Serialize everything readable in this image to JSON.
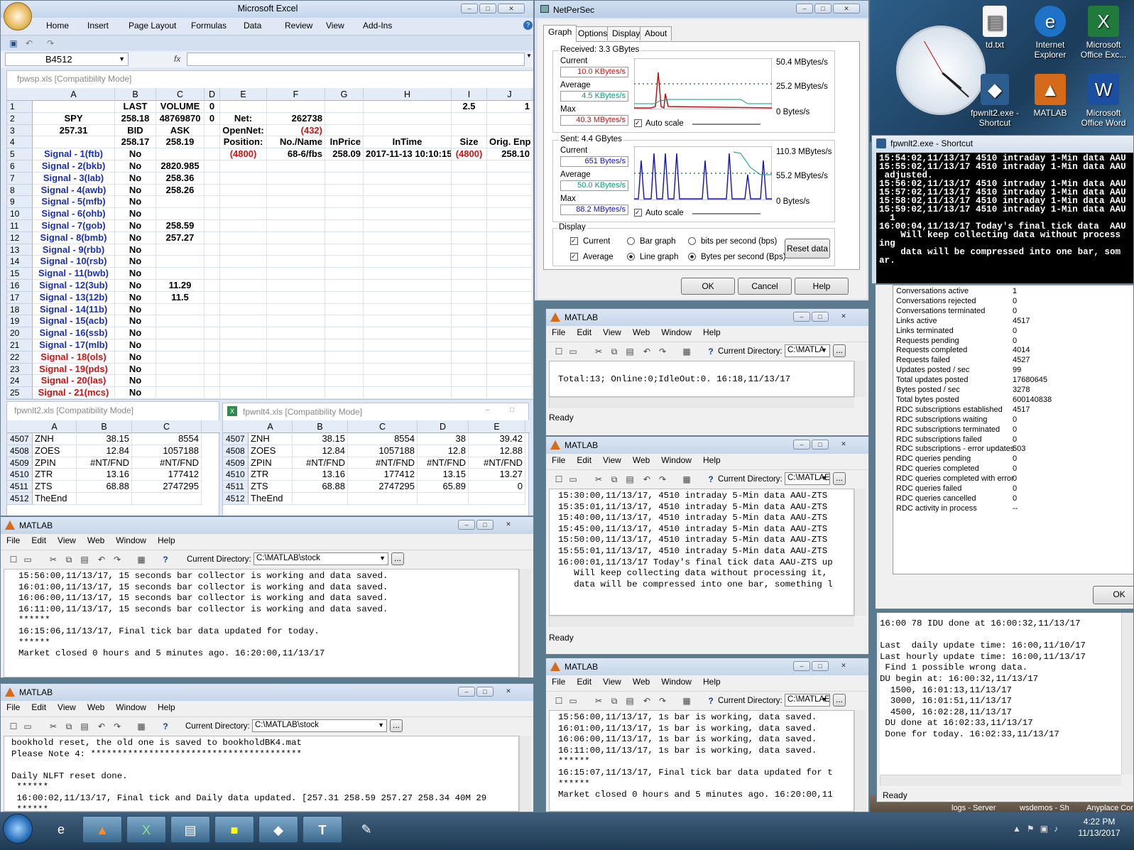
{
  "excel": {
    "title": "Microsoft Excel",
    "ribbon_tabs": [
      "Home",
      "Insert",
      "Page Layout",
      "Formulas",
      "Data",
      "Review",
      "View",
      "Add-Ins"
    ],
    "name_box": "B4512",
    "fx": "fx",
    "wb1_title": "fpwsp.xls  [Compatibility Mode]",
    "col_headers": [
      "A",
      "B",
      "C",
      "D",
      "E",
      "F",
      "G",
      "H",
      "I",
      "J"
    ],
    "rows": [
      {
        "n": "1",
        "a": "",
        "b": "LAST",
        "c": "VOLUME",
        "d": "0",
        "e": "",
        "f": "",
        "g": "",
        "h": "",
        "i": "2.5",
        "j": "1"
      },
      {
        "n": "2",
        "a": "SPY",
        "b": "258.18",
        "c": "48769870",
        "d": "0",
        "e": "Net:",
        "f": "262738",
        "g": "",
        "h": "",
        "i": "",
        "j": ""
      },
      {
        "n": "3",
        "a": "257.31",
        "b": "BID",
        "c": "ASK",
        "d": "",
        "e": "OpenNet:",
        "f": "(432)",
        "g": "",
        "h": "",
        "i": "",
        "j": ""
      },
      {
        "n": "4",
        "a": "",
        "b": "258.17",
        "c": "258.19",
        "d": "",
        "e": "Position:",
        "f": "No./Name",
        "g": "InPrice",
        "h": "InTime",
        "i": "Size",
        "j": "Orig. Enp"
      },
      {
        "n": "5",
        "a": "Signal - 1(ftb)",
        "b": "No",
        "c": "",
        "d": "",
        "e": "(4800)",
        "f": "68-6/fbs",
        "g": "258.09",
        "h": "2017-11-13 10:10:15",
        "i": "(4800)",
        "j": "258.10"
      },
      {
        "n": "6",
        "a": "Signal - 2(bkb)",
        "b": "No",
        "c": "2820.985",
        "d": "",
        "e": "",
        "f": "",
        "g": "",
        "h": "",
        "i": "",
        "j": ""
      },
      {
        "n": "7",
        "a": "Signal - 3(lab)",
        "b": "No",
        "c": "258.36",
        "d": "",
        "e": "",
        "f": "",
        "g": "",
        "h": "",
        "i": "",
        "j": ""
      },
      {
        "n": "8",
        "a": "Signal - 4(awb)",
        "b": "No",
        "c": "258.26",
        "d": "",
        "e": "",
        "f": "",
        "g": "",
        "h": "",
        "i": "",
        "j": ""
      },
      {
        "n": "9",
        "a": "Signal - 5(mfb)",
        "b": "No",
        "c": "",
        "d": "",
        "e": "",
        "f": "",
        "g": "",
        "h": "",
        "i": "",
        "j": ""
      },
      {
        "n": "10",
        "a": "Signal - 6(ohb)",
        "b": "No",
        "c": "",
        "d": "",
        "e": "",
        "f": "",
        "g": "",
        "h": "",
        "i": "",
        "j": ""
      },
      {
        "n": "11",
        "a": "Signal - 7(gob)",
        "b": "No",
        "c": "258.59",
        "d": "",
        "e": "",
        "f": "",
        "g": "",
        "h": "",
        "i": "",
        "j": ""
      },
      {
        "n": "12",
        "a": "Signal - 8(bmb)",
        "b": "No",
        "c": "257.27",
        "d": "",
        "e": "",
        "f": "",
        "g": "",
        "h": "",
        "i": "",
        "j": ""
      },
      {
        "n": "13",
        "a": "Signal - 9(rbb)",
        "b": "No",
        "c": "",
        "d": "",
        "e": "",
        "f": "",
        "g": "",
        "h": "",
        "i": "",
        "j": ""
      },
      {
        "n": "14",
        "a": "Signal - 10(rsb)",
        "b": "No",
        "c": "",
        "d": "",
        "e": "",
        "f": "",
        "g": "",
        "h": "",
        "i": "",
        "j": ""
      },
      {
        "n": "15",
        "a": "Signal - 11(bwb)",
        "b": "No",
        "c": "",
        "d": "",
        "e": "",
        "f": "",
        "g": "",
        "h": "",
        "i": "",
        "j": ""
      },
      {
        "n": "16",
        "a": "Signal - 12(3ub)",
        "b": "No",
        "c": "11.29",
        "d": "",
        "e": "",
        "f": "",
        "g": "",
        "h": "",
        "i": "",
        "j": ""
      },
      {
        "n": "17",
        "a": "Signal - 13(12b)",
        "b": "No",
        "c": "11.5",
        "d": "",
        "e": "",
        "f": "",
        "g": "",
        "h": "",
        "i": "",
        "j": ""
      },
      {
        "n": "18",
        "a": "Signal - 14(11b)",
        "b": "No",
        "c": "",
        "d": "",
        "e": "",
        "f": "",
        "g": "",
        "h": "",
        "i": "",
        "j": ""
      },
      {
        "n": "19",
        "a": "Signal - 15(acb)",
        "b": "No",
        "c": "",
        "d": "",
        "e": "",
        "f": "",
        "g": "",
        "h": "",
        "i": "",
        "j": ""
      },
      {
        "n": "20",
        "a": "Signal - 16(ssb)",
        "b": "No",
        "c": "",
        "d": "",
        "e": "",
        "f": "",
        "g": "",
        "h": "",
        "i": "",
        "j": ""
      },
      {
        "n": "21",
        "a": "Signal - 17(mlb)",
        "b": "No",
        "c": "",
        "d": "",
        "e": "",
        "f": "",
        "g": "",
        "h": "",
        "i": "",
        "j": ""
      },
      {
        "n": "22",
        "a": "Signal - 18(ols)",
        "b": "No",
        "c": "",
        "d": "",
        "e": "",
        "f": "",
        "g": "",
        "h": "",
        "i": "",
        "j": ""
      },
      {
        "n": "23",
        "a": "Signal - 19(pds)",
        "b": "No",
        "c": "",
        "d": "",
        "e": "",
        "f": "",
        "g": "",
        "h": "",
        "i": "",
        "j": ""
      },
      {
        "n": "24",
        "a": "Signal - 20(las)",
        "b": "No",
        "c": "",
        "d": "",
        "e": "",
        "f": "",
        "g": "",
        "h": "",
        "i": "",
        "j": ""
      },
      {
        "n": "25",
        "a": "Signal - 21(mcs)",
        "b": "No",
        "c": "",
        "d": "",
        "e": "",
        "f": "",
        "g": "",
        "h": "",
        "i": "",
        "j": ""
      }
    ],
    "wb2_title": "fpwnlt2.xls  [Compatibility Mode]",
    "wb2_cols": [
      "A",
      "B",
      "C"
    ],
    "wb2_rows": [
      {
        "n": "4507",
        "a": "ZNH",
        "b": "38.15",
        "c": "8554"
      },
      {
        "n": "4508",
        "a": "ZOES",
        "b": "12.84",
        "c": "1057188"
      },
      {
        "n": "4509",
        "a": "ZPIN",
        "b": "#NT/FND",
        "c": "#NT/FND"
      },
      {
        "n": "4510",
        "a": "ZTR",
        "b": "13.16",
        "c": "177412"
      },
      {
        "n": "4511",
        "a": "ZTS",
        "b": "68.88",
        "c": "2747295"
      },
      {
        "n": "4512",
        "a": "TheEnd",
        "b": "",
        "c": ""
      }
    ],
    "wb3_title": "fpwnlt4.xls  [Compatibility Mode]",
    "wb3_cols": [
      "A",
      "B",
      "C",
      "D",
      "E"
    ],
    "wb3_rows": [
      {
        "n": "4507",
        "a": "ZNH",
        "b": "38.15",
        "c": "8554",
        "d": "38",
        "e": "39.42"
      },
      {
        "n": "4508",
        "a": "ZOES",
        "b": "12.84",
        "c": "1057188",
        "d": "12.8",
        "e": "12.88"
      },
      {
        "n": "4509",
        "a": "ZPIN",
        "b": "#NT/FND",
        "c": "#NT/FND",
        "d": "#NT/FND",
        "e": "#NT/FND"
      },
      {
        "n": "4510",
        "a": "ZTR",
        "b": "13.16",
        "c": "177412",
        "d": "13.15",
        "e": "13.27"
      },
      {
        "n": "4511",
        "a": "ZTS",
        "b": "68.88",
        "c": "2747295",
        "d": "65.89",
        "e": "0"
      },
      {
        "n": "4512",
        "a": "TheEnd",
        "b": "",
        "c": "",
        "d": "",
        "e": ""
      }
    ]
  },
  "matlab": {
    "title": "MATLAB",
    "menu": [
      "File",
      "Edit",
      "View",
      "Web",
      "Window",
      "Help"
    ],
    "cd_label": "Current Directory:",
    "ready": "Ready",
    "m1_dir": "C:\\MATLAB\\stock",
    "m1_lines": [
      "15:56:00,11/13/17, 15 seconds bar collector is working and data saved.",
      "16:01:00,11/13/17, 15 seconds bar collector is working and data saved.",
      "16:06:00,11/13/17, 15 seconds bar collector is working and data saved.",
      "16:11:00,11/13/17, 15 seconds bar collector is working and data saved.",
      "******",
      "16:15:06,11/13/17, Final tick bar data updated for today.",
      "******",
      "Market closed 0 hours and 5 minutes ago. 16:20:00,11/13/17"
    ],
    "m2_dir": "C:\\MATLAB\\stock",
    "m2_lines": [
      "bookhold reset, the old one is saved to bookholdBK4.mat",
      "Please Note 4: ****************************************",
      "",
      "Daily NLFT reset done.",
      " ******",
      " 16:00:02,11/13/17, Final tick and Daily data updated. [257.31 258.59 257.27 258.34 40M 29",
      " ******"
    ],
    "m3_dir": "C:\\MATLA",
    "m3_lines": [
      "",
      "Total:13; Online:0;IdleOut:0. 16:18,11/13/17"
    ],
    "m4_dir": "C:\\MATLAE",
    "m4_lines": [
      "15:30:00,11/13/17, 4510 intraday 5-Min data AAU-ZTS",
      "15:35:01,11/13/17, 4510 intraday 5-Min data AAU-ZTS",
      "15:40:00,11/13/17, 4510 intraday 5-Min data AAU-ZTS",
      "15:45:00,11/13/17, 4510 intraday 5-Min data AAU-ZTS",
      "15:50:00,11/13/17, 4510 intraday 5-Min data AAU-ZTS",
      "15:55:01,11/13/17, 4510 intraday 5-Min data AAU-ZTS",
      "16:00:01,11/13/17 Today's final tick data AAU-ZTS up",
      "   Will keep collecting data without processing it,",
      "   data will be compressed into one bar, something l"
    ],
    "m5_dir": "C:\\MATLAE",
    "m5_lines": [
      "15:56:00,11/13/17, 1s bar is working, data saved.",
      "16:01:00,11/13/17, 1s bar is working, data saved.",
      "16:06:00,11/13/17, 1s bar is working, data saved.",
      "16:11:00,11/13/17, 1s bar is working, data saved.",
      "******",
      "16:15:07,11/13/17, Final tick bar data updated for t",
      "******",
      "Market closed 0 hours and 5 minutes ago. 16:20:00,11"
    ]
  },
  "netpersec": {
    "title": "NetPerSec",
    "tabs": [
      "Graph",
      "Options",
      "Display",
      "About"
    ],
    "received_title": "Received: 3.3 GBytes",
    "sent_title": "Sent: 4.4 GBytes",
    "lbl_current": "Current",
    "lbl_average": "Average",
    "lbl_max": "Max",
    "recv_current": "10.0 KBytes/s",
    "recv_average": "4.5 KBytes/s",
    "recv_max": "40.3 MBytes/s",
    "recv_scale": [
      "50.4 MBytes/s",
      "25.2 MBytes/s",
      "0  Bytes/s"
    ],
    "sent_current": "651  Bytes/s",
    "sent_average": "50.0 KBytes/s",
    "sent_max": "88.2 MBytes/s",
    "sent_scale": [
      "110.3 MBytes/s",
      "55.2 MBytes/s",
      "0  Bytes/s"
    ],
    "auto_scale": "Auto scale",
    "display_title": "Display",
    "opt_current": "Current",
    "opt_average": "Average",
    "opt_bar": "Bar graph",
    "opt_line": "Line graph",
    "opt_bits": "bits per second (bps)",
    "opt_bytes": "Bytes per second (Bps)",
    "reset": "Reset data",
    "ok": "OK",
    "cancel": "Cancel",
    "help": "Help",
    "colors": {
      "received_value": "#d01010",
      "average_value": "#00a080",
      "sent_value": "#1010d0"
    }
  },
  "console": {
    "title": "fpwnlt2.exe - Shortcut",
    "lines": [
      "15:54:02,11/13/17 4510 intraday 1-Min data AAU",
      "15:55:02,11/13/17 4510 intraday 1-Min data AAU",
      " adjusted.",
      "15:56:02,11/13/17 4510 intraday 1-Min data AAU",
      "15:57:02,11/13/17 4510 intraday 1-Min data AAU",
      "15:58:02,11/13/17 4510 intraday 1-Min data AAU",
      "15:59:02,11/13/17 4510 intraday 1-Min data AAU",
      "  1",
      "16:00:04,11/13/17 Today's final tick data  AAU",
      "    Will keep collecting data without process",
      "ing",
      "    data will be compressed into one bar, som",
      "ar."
    ]
  },
  "rdc": {
    "items": [
      {
        "label": "Conversations active",
        "value": "1"
      },
      {
        "label": "Conversations rejected",
        "value": "0"
      },
      {
        "label": "Conversations terminated",
        "value": "0"
      },
      {
        "label": "Links active",
        "value": "4517"
      },
      {
        "label": "Links terminated",
        "value": "0"
      },
      {
        "label": "Requests pending",
        "value": "0"
      },
      {
        "label": "Requests completed",
        "value": "4014"
      },
      {
        "label": "Requests failed",
        "value": "4527"
      },
      {
        "label": "Updates posted / sec",
        "value": "99"
      },
      {
        "label": "Total updates posted",
        "value": "17680645"
      },
      {
        "label": "Bytes posted / sec",
        "value": "3278"
      },
      {
        "label": "Total bytes posted",
        "value": "600140838"
      },
      {
        "label": "RDC subscriptions established",
        "value": "4517"
      },
      {
        "label": "RDC subscriptions waiting",
        "value": "0"
      },
      {
        "label": "RDC subscriptions terminated",
        "value": "0"
      },
      {
        "label": "RDC subscriptions failed",
        "value": "0"
      },
      {
        "label": "RDC subscriptions - error updates",
        "value": "503"
      },
      {
        "label": "RDC queries pending",
        "value": "0"
      },
      {
        "label": "RDC queries completed",
        "value": "0"
      },
      {
        "label": "RDC queries completed with error",
        "value": "0"
      },
      {
        "label": "RDC queries failed",
        "value": "0"
      },
      {
        "label": "RDC queries cancelled",
        "value": "0"
      },
      {
        "label": "RDC activity in process",
        "value": "--"
      }
    ],
    "ok": "OK"
  },
  "log6": {
    "lines": [
      "16:00 78 IDU done at 16:00:32,11/13/17",
      "",
      "Last  daily update time: 16:00,11/10/17",
      "Last hourly update time: 16:00,11/13/17",
      " Find 1 possible wrong data.",
      "DU begin at: 16:00:32,11/13/17",
      "  1500, 16:01:13,11/13/17",
      "  3000, 16:01:51,11/13/17",
      "  4500, 16:02:28,11/13/17",
      " DU done at 16:02:33,11/13/17",
      " Done for today. 16:02:33,11/13/17"
    ],
    "ready": "Ready"
  },
  "desktop": {
    "icons": [
      {
        "label": "td.txt",
        "icon": "document-icon"
      },
      {
        "label": "Internet Explorer",
        "icon": "ie-icon"
      },
      {
        "label": "Microsoft Office Exc...",
        "icon": "excel-icon"
      },
      {
        "label": "fpwnlt2.exe - Shortcut",
        "icon": "python-icon"
      },
      {
        "label": "MATLAB",
        "icon": "matlab-icon"
      },
      {
        "label": "Microsoft Office Word",
        "icon": "word-icon"
      }
    ],
    "bottom_labels": [
      "logs - Server",
      "wsdemos - Shortcut",
      "Anyplace Control"
    ]
  },
  "taskbar": {
    "time": "4:22 PM",
    "date": "11/13/2017"
  }
}
